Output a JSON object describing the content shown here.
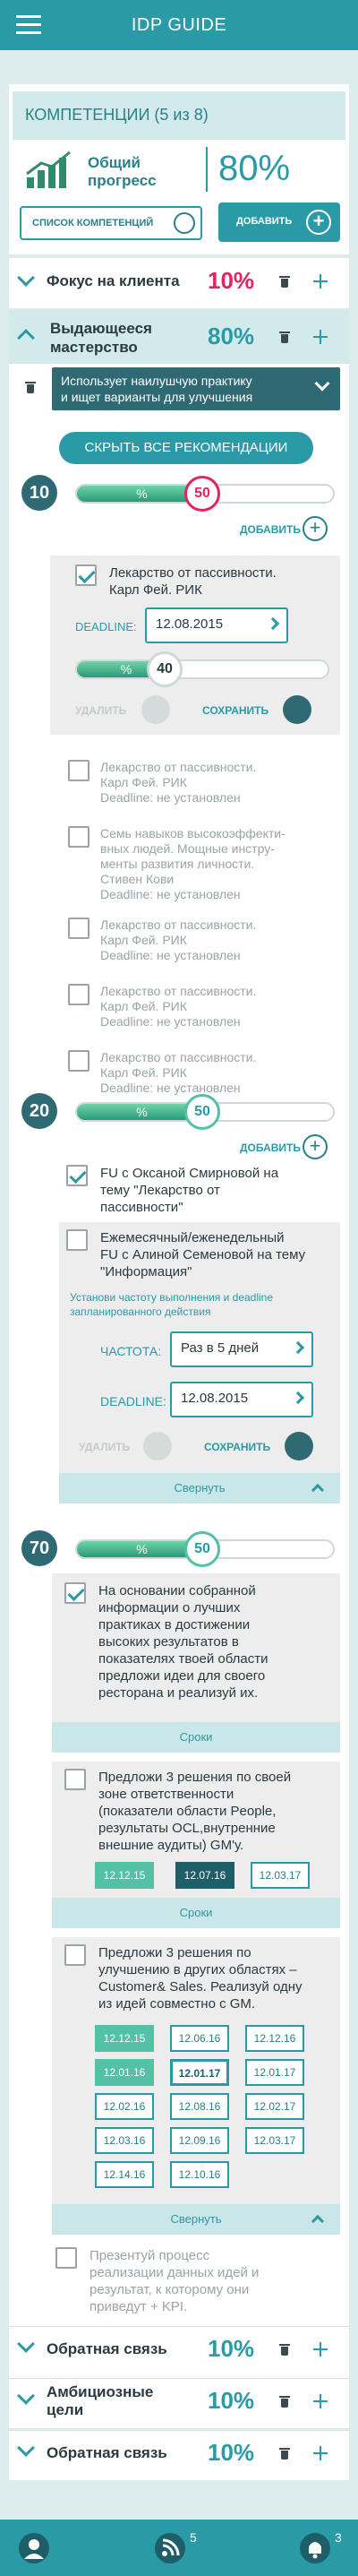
{
  "header": {
    "title": "IDP GUIDE"
  },
  "competencies": {
    "title": "КОМПЕТЕНЦИИ (5 из 8)",
    "progress_label_1": "Общий",
    "progress_label_2": "прогресс",
    "progress_value": "80%",
    "list_btn": "СПИСОК КОМПЕТЕНЦИЙ",
    "add_btn": "ДОБАВИТЬ"
  },
  "client": {
    "title": "Фокус на клиента",
    "value": "10%"
  },
  "mastery": {
    "title_1": "Выдающееся",
    "title_2": "мастерство",
    "value": "80%",
    "practice_1": "Использует наилушчую практику",
    "practice_2": "и ищет варианты для улучшения",
    "hide_btn": "СКРЫТЬ ВСЕ РЕКОМЕНДАЦИИ"
  },
  "block10": {
    "num": "10",
    "pct": "%",
    "knob": "50",
    "progress": 0.5,
    "add": "ДОБАВИТЬ",
    "item_1": "Лекарство от пассивности.",
    "item_2": "Карл Фей. РИК",
    "deadline_label": "DEADLINE:",
    "deadline": "12.08.2015",
    "sub_pct": "%",
    "sub_knob": "40",
    "sub_progress": 0.4,
    "delete": "УДАЛИТЬ",
    "save": "СОХРАНИТЬ",
    "list": [
      {
        "lines": [
          "Лекарство от пассивности.",
          "Карл Фей. РИК",
          "Deadline: не установлен"
        ]
      },
      {
        "lines": [
          "Семь навыков высокоэффекти-",
          "вных людей. Мощные инстру-",
          "менты развития личности.",
          "Стивен Кови",
          "Deadline: не установлен"
        ]
      },
      {
        "lines": [
          "Лекарство от пассивности.",
          "Карл Фей. РИК",
          "Deadline: не установлен"
        ]
      },
      {
        "lines": [
          "Лекарство от пассивности.",
          "Карл Фей. РИК",
          "Deadline: не установлен"
        ]
      },
      {
        "lines": [
          "Лекарство от пассивности.",
          "Карл Фей. РИК",
          "Deadline: не установлен"
        ]
      }
    ]
  },
  "block20": {
    "num": "20",
    "pct": "%",
    "knob": "50",
    "progress": 0.5,
    "add": "ДОБАВИТЬ",
    "fu1": [
      "FU с Оксаной Смирновой на",
      "тему \"Лекарство от",
      "пассивности\""
    ],
    "fu2": [
      "Ежемесячный/еженедельный",
      "FU с Алиной Семеновой на тему",
      "\"Информация\""
    ],
    "hint": [
      "Установи частоту выполнения и deadline",
      "запланированного действия"
    ],
    "freq_label": "ЧАСТОТА:",
    "freq": "Раз в 5 дней",
    "deadline_label": "DEADLINE:",
    "deadline": "12.08.2015",
    "delete": "УДАЛИТЬ",
    "save": "СОХРАНИТЬ",
    "collapse": "Свернуть"
  },
  "block70": {
    "num": "70",
    "pct": "%",
    "knob": "50",
    "progress": 0.5,
    "t1": [
      "На основании собранной",
      "информации о лучших",
      "практиках в достижении",
      "высоких результатов в",
      "показателях твоей области",
      "предложи идеи для своего",
      "ресторана и реализуй их."
    ],
    "terms": "Сроки",
    "t2": [
      "Предложи 3 решения по своей",
      "зоне ответственности",
      "(показатели области People,",
      "результаты OCL,внутренние",
      "внешние аудиты) GM'у."
    ],
    "dates2": [
      "12.12.15",
      "12.07.16",
      "12.03.17"
    ],
    "terms2": "Сроки",
    "t3": [
      "Предложи 3 решения по",
      "улучшению в других областях –",
      "Customer& Sales. Реализуй одну",
      "из идей совместно с GM."
    ],
    "dates3": [
      "12.12.15",
      "12.06.16",
      "12.12.16",
      "12.01.16",
      "12.01.17",
      "12.01.17",
      "12.02.16",
      "12.08.16",
      "12.02.17",
      "12.03.16",
      "12.09.16",
      "12.03.17",
      "12.14.16",
      "12.10.16"
    ],
    "collapse": "Свернуть",
    "t4": [
      "Презентуй процесс",
      "реализации данных идей и",
      "результат, к которому они",
      "приведут + KPI."
    ]
  },
  "feedback1": {
    "title": "Обратная связь",
    "value": "10%"
  },
  "ambitious": {
    "title_1": "Амбициозные",
    "title_2": "цели",
    "value": "10%"
  },
  "feedback2": {
    "title": "Обратная связь",
    "value": "10%"
  },
  "tabbar": {
    "feed_badge": "5",
    "bell_badge": "3"
  }
}
